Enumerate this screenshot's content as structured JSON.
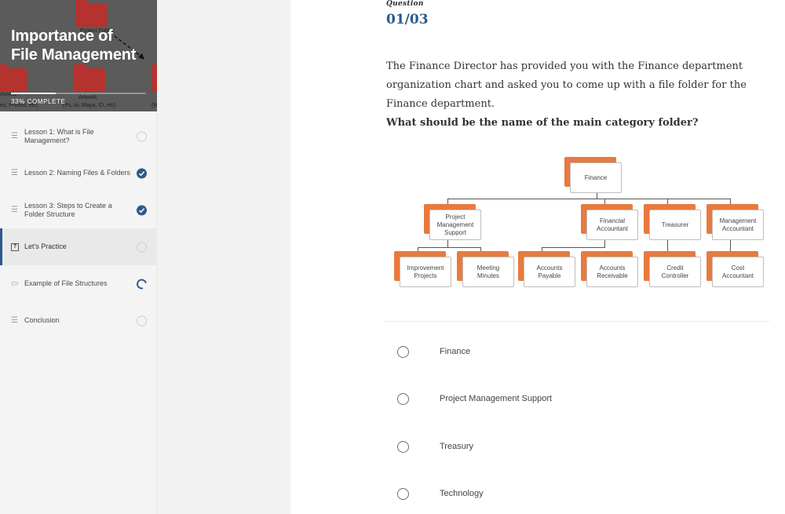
{
  "sidebar": {
    "title": "Importance of File Management",
    "progress_text": "33% COMPLETE",
    "progress_fraction": 0.33,
    "header_background_labels": {
      "project_folder": "Project Folder",
      "assets_line1": "Assets",
      "assets_line2": "es, Photos, etc)",
      "artwork_line1": "Artwork",
      "artwork_line2": "(Ps, Ai, Maya, ID, etc)",
      "w": "(W"
    },
    "lessons": [
      {
        "label": "Lesson 1: What is File Management?",
        "icon": "lines-icon",
        "status": "not-started"
      },
      {
        "label": "Lesson 2: Naming Files & Folders",
        "icon": "lines-icon",
        "status": "completed"
      },
      {
        "label": "Lesson 3: Steps to Create a Folder Structure",
        "icon": "lines-icon",
        "status": "completed"
      },
      {
        "label": "Let's Practice",
        "icon": "question-box-icon",
        "status": "not-started",
        "active": true
      },
      {
        "label": "Example of File Structures",
        "icon": "media-icon",
        "status": "in-progress"
      },
      {
        "label": "Conclusion",
        "icon": "lines-icon",
        "status": "not-started"
      }
    ]
  },
  "main": {
    "question_label": "Question",
    "question_number": "01/03",
    "prompt": "The Finance Director has provided you with the Finance department organization chart and asked you to come up with a file folder for the Finance department.",
    "question": "What should be the name of the main category folder?",
    "org_chart": {
      "root": "Finance",
      "level2": [
        "Project Management Support",
        "Financial Accountant",
        "Treasurer",
        "Management Accountant"
      ],
      "level3": [
        "Improvement Projects",
        "Meeting Minutes",
        "Accounts Payable",
        "Accounts Receivable",
        "Credit Controller",
        "Cost Accountant"
      ]
    },
    "options": [
      "Finance",
      "Project Management Support",
      "Treasury",
      "Technology"
    ]
  },
  "colors": {
    "accent": "#2a5a8f",
    "folder_orange": "#e87a3e",
    "header_bg": "#5b5b5b",
    "folder_red": "#b5322e"
  }
}
